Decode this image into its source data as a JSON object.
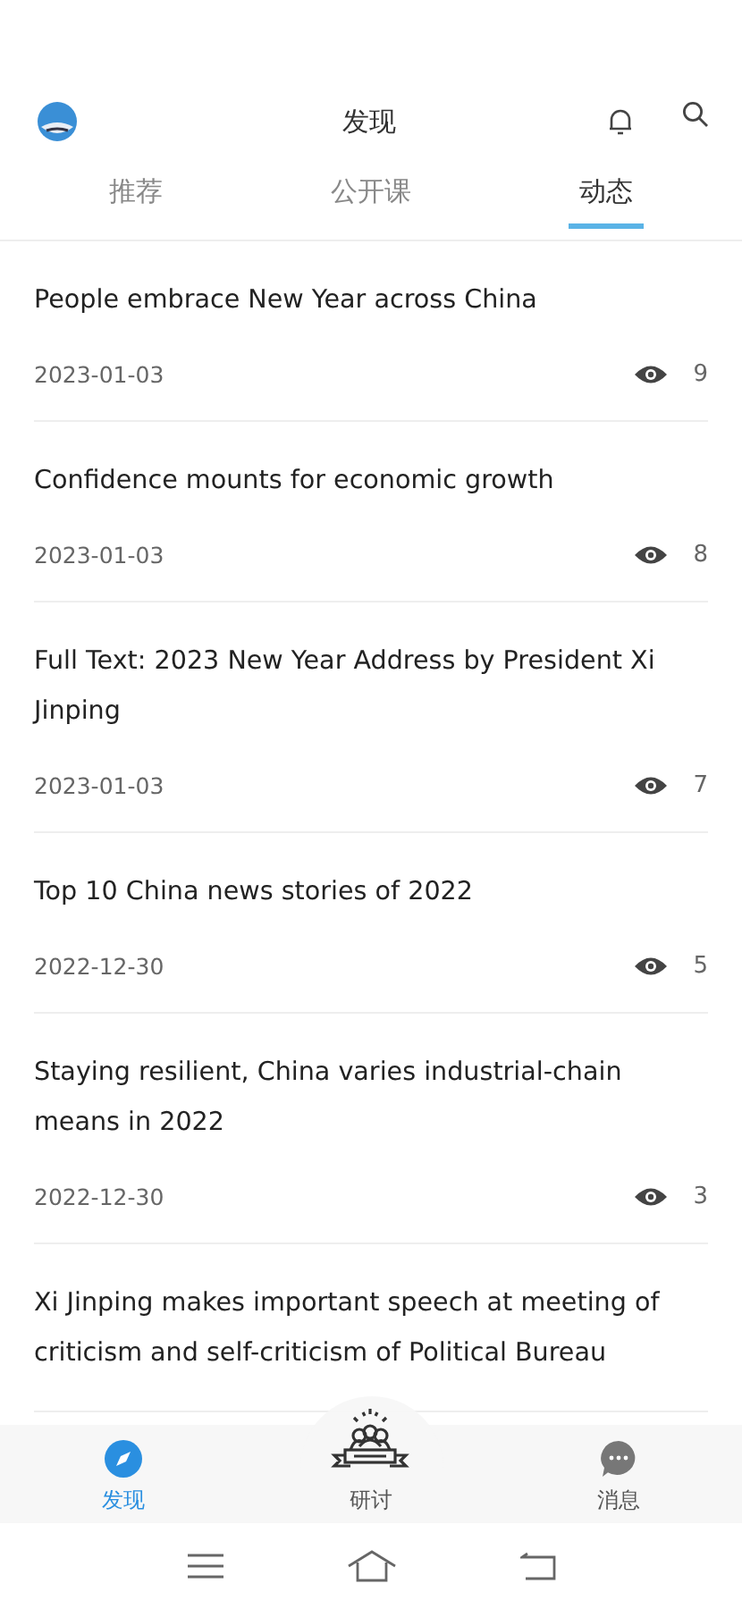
{
  "header": {
    "title": "发现"
  },
  "tabs": [
    {
      "label": "推荐",
      "selected": false
    },
    {
      "label": "公开课",
      "selected": false
    },
    {
      "label": "动态",
      "selected": true
    }
  ],
  "articles": [
    {
      "title": "People embrace New Year across China",
      "date": "2023-01-03",
      "views": "9"
    },
    {
      "title": "Confidence mounts for economic growth",
      "date": "2023-01-03",
      "views": "8"
    },
    {
      "title": "Full Text: 2023 New Year Address by President Xi Jinping",
      "date": "2023-01-03",
      "views": "7"
    },
    {
      "title": "Top 10 China news stories of 2022",
      "date": "2022-12-30",
      "views": "5"
    },
    {
      "title": "Staying resilient, China varies industrial-chain means in 2022",
      "date": "2022-12-30",
      "views": "3"
    },
    {
      "title": "Xi Jinping makes important speech at meeting of criticism and self-criticism of Political Bureau"
    }
  ],
  "bottom_nav": [
    {
      "kind": "discover",
      "label": "发现",
      "selected": true
    },
    {
      "kind": "seminar",
      "label": "研讨",
      "selected": false
    },
    {
      "kind": "messages",
      "label": "消息",
      "selected": false
    }
  ]
}
